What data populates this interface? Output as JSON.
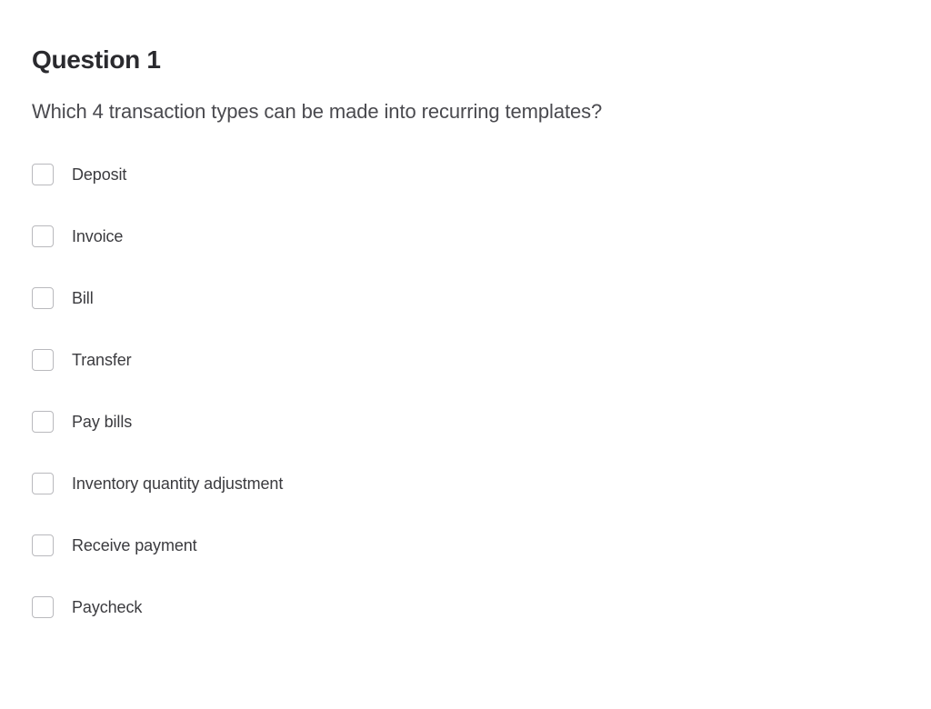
{
  "question": {
    "title": "Question 1",
    "prompt": "Which 4 transaction types can be made into recurring templates?",
    "options": [
      {
        "label": "Deposit"
      },
      {
        "label": "Invoice"
      },
      {
        "label": "Bill"
      },
      {
        "label": "Transfer"
      },
      {
        "label": "Pay bills"
      },
      {
        "label": "Inventory quantity adjustment"
      },
      {
        "label": "Receive payment"
      },
      {
        "label": "Paycheck"
      }
    ]
  }
}
